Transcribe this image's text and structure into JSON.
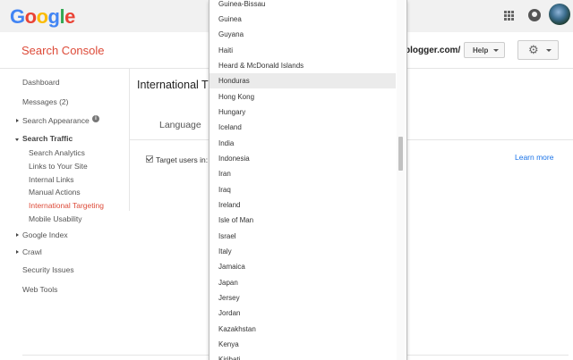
{
  "logo": {
    "letters": [
      "G",
      "o",
      "o",
      "g",
      "l",
      "e"
    ]
  },
  "product": {
    "name": "Search Console"
  },
  "header": {
    "site_url": "blogger.com/",
    "help_label": "Help"
  },
  "sidebar": {
    "dashboard": "Dashboard",
    "messages": "Messages (2)",
    "search_appearance": "Search Appearance",
    "search_traffic": "Search Traffic",
    "search_traffic_items": [
      "Search Analytics",
      "Links to Your Site",
      "Internal Links",
      "Manual Actions",
      "International Targeting",
      "Mobile Usability"
    ],
    "google_index": "Google Index",
    "crawl": "Crawl",
    "security_issues": "Security Issues",
    "web_tools": "Web Tools"
  },
  "main": {
    "title": "International T",
    "tab_language": "Language",
    "target_label": "Target users in:",
    "learn_more": "Learn more"
  },
  "dropdown": {
    "items": [
      "Guinea-Bissau",
      "Guinea",
      "Guyana",
      "Haiti",
      "Heard & McDonald Islands",
      "Honduras",
      "Hong Kong",
      "Hungary",
      "Iceland",
      "India",
      "Indonesia",
      "Iran",
      "Iraq",
      "Ireland",
      "Isle of Man",
      "Israel",
      "Italy",
      "Jamaica",
      "Japan",
      "Jersey",
      "Jordan",
      "Kazakhstan",
      "Kenya",
      "Kiribati"
    ],
    "highlighted": "Honduras"
  },
  "colors": {
    "brand_red": "#dd4b39",
    "link_blue": "#1a73e8",
    "highlight_bg": "#ebebeb"
  },
  "icons": [
    "apps-grid-icon",
    "account-icon",
    "gear-icon",
    "info-icon",
    "chevron-down-icon"
  ]
}
